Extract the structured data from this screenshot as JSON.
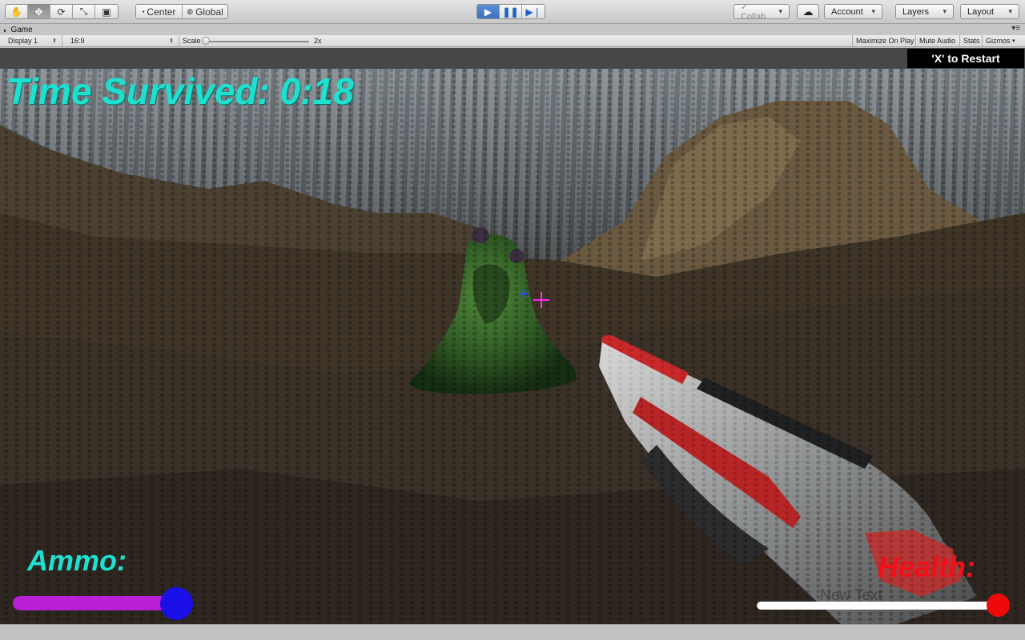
{
  "toolbar": {
    "tools": [
      {
        "icon": "hand-icon",
        "glyph": "✋"
      },
      {
        "icon": "move-icon",
        "glyph": "✥"
      },
      {
        "icon": "rotate-icon",
        "glyph": "⟳"
      },
      {
        "icon": "scale-icon",
        "glyph": "⤡"
      },
      {
        "icon": "rect-icon",
        "glyph": "▣"
      }
    ],
    "pivot_center": "Center",
    "pivot_global": "Global",
    "collab": "Collab",
    "account": "Account",
    "layers": "Layers",
    "layout": "Layout"
  },
  "tab": {
    "title": "Game"
  },
  "gamebar": {
    "display": "Display 1",
    "aspect": "16:9",
    "scale_label": "Scale",
    "scale_value": "2x",
    "maximize": "Maximize On Play",
    "mute": "Mute Audio",
    "stats": "Stats",
    "gizmos": "Gizmos"
  },
  "hud": {
    "time_survived": "Time Survived: 0:18",
    "restart": "'X' to Restart",
    "ammo_label": "Ammo:",
    "ammo_level": 0.97,
    "health_label": "Health:",
    "health_placeholder": "New Text",
    "health_level": 0.97,
    "colors": {
      "cyan": "#1ee0d0",
      "ammo_fill": "#b91fd6",
      "ammo_knob": "#1c10e8",
      "health_text": "#f0101a",
      "health_knob": "#ee0a0a"
    }
  }
}
